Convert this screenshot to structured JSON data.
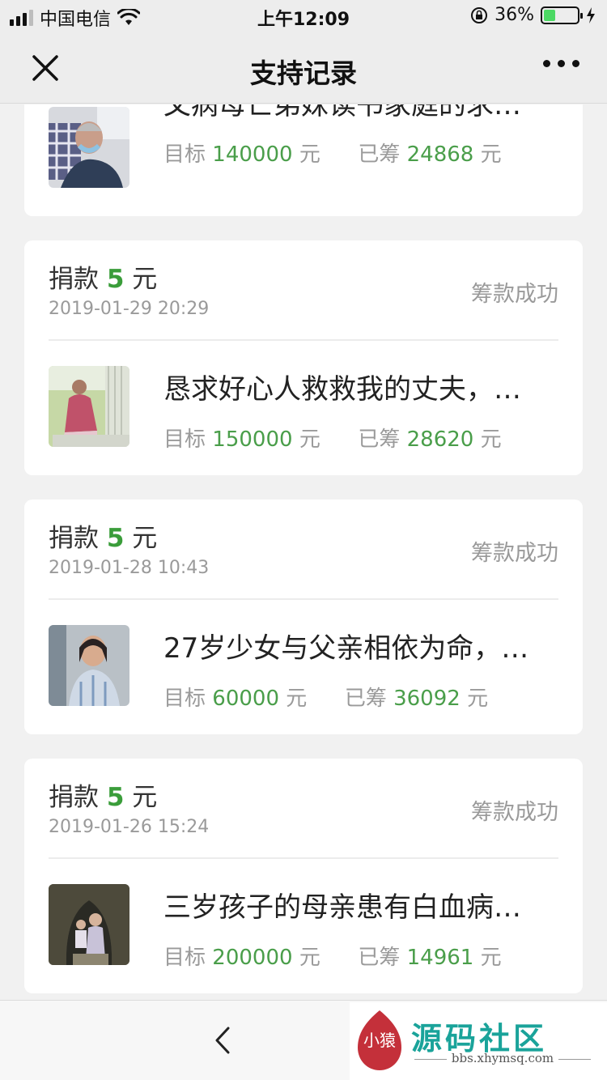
{
  "status_bar": {
    "carrier": "中国电信",
    "time": "上午12:09",
    "battery_percent": "36%",
    "battery_level": 0.36
  },
  "nav": {
    "title": "支持记录",
    "close_icon": "close-icon",
    "more_icon": "more-icon"
  },
  "records": [
    {
      "project_title": "父病母亡弟妹读书家庭的求…",
      "target_label": "目标",
      "target_amount": "140000",
      "raised_label": "已筹",
      "raised_amount": "24868",
      "unit": "元"
    },
    {
      "donation_label": "捐款",
      "donation_amount": "5",
      "unit": "元",
      "date": "2019-01-29 20:29",
      "status": "筹款成功",
      "project_title": "恳求好心人救救我的丈夫，…",
      "target_label": "目标",
      "target_amount": "150000",
      "raised_label": "已筹",
      "raised_amount": "28620"
    },
    {
      "donation_label": "捐款",
      "donation_amount": "5",
      "unit": "元",
      "date": "2019-01-28 10:43",
      "status": "筹款成功",
      "project_title": "27岁少女与父亲相依为命，…",
      "target_label": "目标",
      "target_amount": "60000",
      "raised_label": "已筹",
      "raised_amount": "36092"
    },
    {
      "donation_label": "捐款",
      "donation_amount": "5",
      "unit": "元",
      "date": "2019-01-26 15:24",
      "status": "筹款成功",
      "project_title": "三岁孩子的母亲患有白血病…",
      "target_label": "目标",
      "target_amount": "200000",
      "raised_label": "已筹",
      "raised_amount": "14961"
    }
  ],
  "bottom": {
    "back_icon": "chevron-left-icon"
  },
  "watermark": {
    "logo_text": "小猿",
    "title": "源码社区",
    "url": "bbs.xhymsq.com"
  },
  "colors": {
    "accent_green": "#3a9d3a",
    "watermark_teal": "#1aa39a"
  }
}
